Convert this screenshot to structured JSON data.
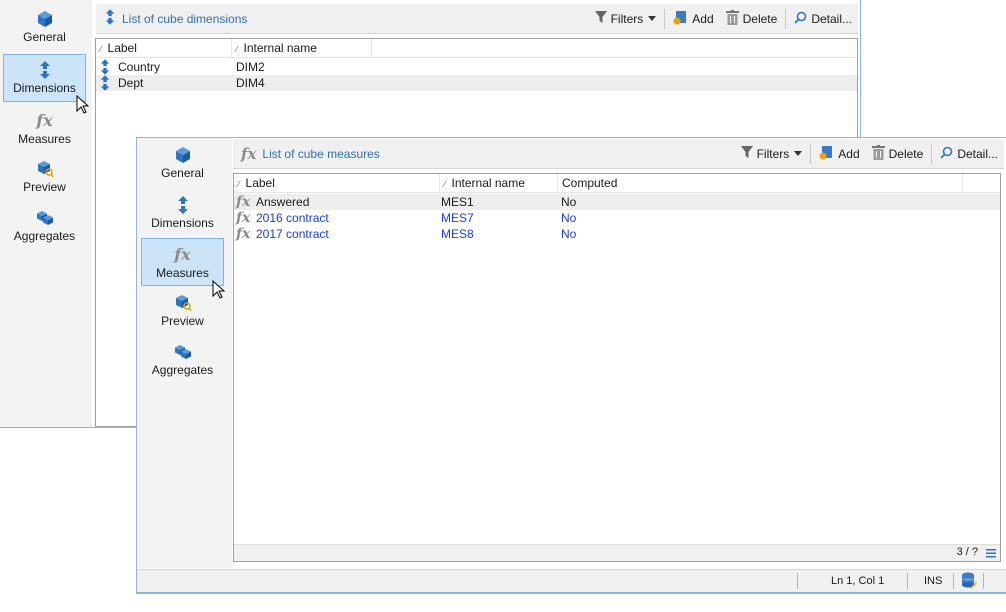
{
  "back_window": {
    "nav": [
      {
        "label": "General",
        "icon": "cube-icon",
        "active": false
      },
      {
        "label": "Dimensions",
        "icon": "dimension-arrows-icon",
        "active": true
      },
      {
        "label": "Measures",
        "icon": "fx-icon",
        "active": false
      },
      {
        "label": "Preview",
        "icon": "preview-icon",
        "active": false
      },
      {
        "label": "Aggregates",
        "icon": "aggregates-icon",
        "active": false
      }
    ],
    "toolbar": {
      "title": "List of cube dimensions",
      "filters": "Filters",
      "add": "Add",
      "delete": "Delete",
      "detail": "Detail..."
    },
    "columns": [
      "Label",
      "Internal name"
    ],
    "rows": [
      {
        "label": "Country",
        "internal": "DIM2"
      },
      {
        "label": "Dept",
        "internal": "DIM4"
      }
    ]
  },
  "front_window": {
    "nav": [
      {
        "label": "General",
        "icon": "cube-icon",
        "active": false
      },
      {
        "label": "Dimensions",
        "icon": "dimension-arrows-icon",
        "active": false
      },
      {
        "label": "Measures",
        "icon": "fx-icon",
        "active": true
      },
      {
        "label": "Preview",
        "icon": "preview-icon",
        "active": false
      },
      {
        "label": "Aggregates",
        "icon": "aggregates-icon",
        "active": false
      }
    ],
    "toolbar": {
      "title": "List of cube measures",
      "filters": "Filters",
      "add": "Add",
      "delete": "Delete",
      "detail": "Detail..."
    },
    "columns": [
      "Label",
      "Internal name",
      "Computed"
    ],
    "rows": [
      {
        "label": "Answered",
        "internal": "MES1",
        "computed": "No"
      },
      {
        "label": "2016 contract",
        "internal": "MES7",
        "computed": "No"
      },
      {
        "label": "2017 contract",
        "internal": "MES8",
        "computed": "No"
      }
    ],
    "fx_glyph": "fx",
    "footer_count": "3 / ?",
    "status": {
      "position": "Ln 1, Col 1",
      "mode": "INS"
    }
  },
  "colors": {
    "accent": "#2f6fb5",
    "selection": "#cce4f7",
    "link_text": "#1a3fd0"
  }
}
